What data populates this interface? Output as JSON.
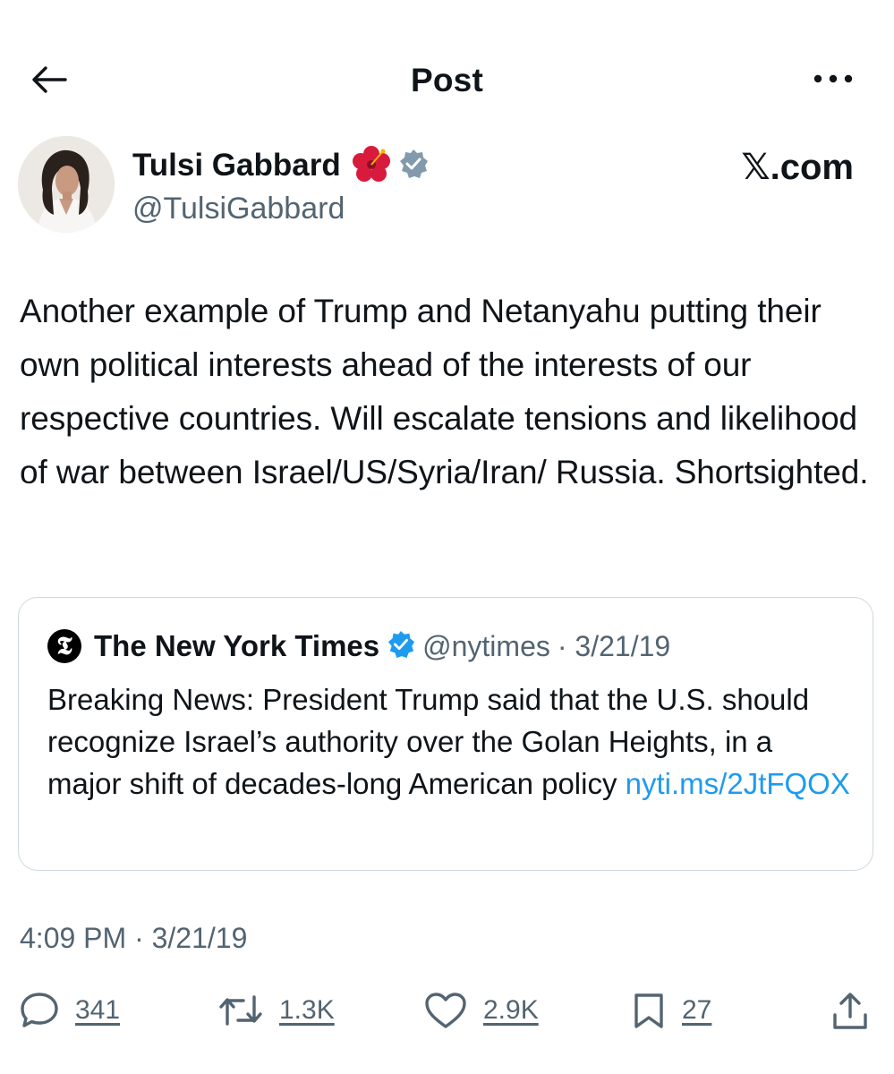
{
  "header": {
    "title": "Post",
    "back_icon": "arrow-left-icon",
    "more_icon": "ellipsis-icon"
  },
  "author": {
    "name": "Tulsi Gabbard",
    "handle": "@TulsiGabbard",
    "emoji": "🌺",
    "verified_color": "#829aab",
    "site": "𝕏.com"
  },
  "post": {
    "text": "Another example of Trump and Netanyahu putting their own political interests ahead of the interests of our respective countries. Will escalate tensions and likelihood of war between Israel/US/Syria/Iran/ Russia. Shortsighted.",
    "timestamp": "4:09 PM · 3/21/19"
  },
  "quote": {
    "logo_letter": "𝕿",
    "name": "The New York Times",
    "verified_color": "#1d9bf0",
    "handle": "@nytimes",
    "date": "· 3/21/19",
    "text": "Breaking News: President Trump said that the U.S. should recognize Israel’s authority over the Golan Heights, in a major shift of decades-long American policy",
    "link": "nyti.ms/2JtFQOX"
  },
  "actions": {
    "replies": "341",
    "reposts": "1.3K",
    "likes": "2.9K",
    "bookmarks": "27"
  },
  "colors": {
    "text_primary": "#0f1419",
    "text_secondary": "#536471",
    "link": "#1d9bf0",
    "border": "#cfd9de"
  }
}
